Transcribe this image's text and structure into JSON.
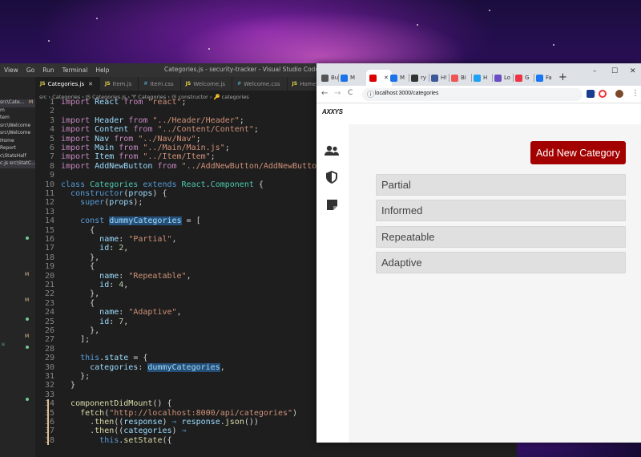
{
  "vscode": {
    "menu": [
      "View",
      "Go",
      "Run",
      "Terminal",
      "Help"
    ],
    "window_title": "Categories.js - security-tracker - Visual Studio Code",
    "tabs": [
      {
        "type": "JS",
        "label": "Categories.js",
        "close": "✕",
        "active": true
      },
      {
        "type": "JS",
        "label": "Item.js",
        "active": false
      },
      {
        "type": "#",
        "label": "Item.css",
        "active": false
      },
      {
        "type": "JS",
        "label": "Welcome.js",
        "active": false
      },
      {
        "type": "#",
        "label": "Welcome.css",
        "active": false
      },
      {
        "type": "JS",
        "label": "Home",
        "active": false
      }
    ],
    "breadcrumb": "src › Categories › JS Categories.js › 🝖 Categories › ⓜ constructor › 🔑 categories",
    "explorer": [
      {
        "name": "src\\Cate...",
        "mark": "M"
      },
      {
        "name": "m",
        "mark": ""
      },
      {
        "name": "tem",
        "mark": ""
      },
      {
        "name": "src\\Welcome",
        "mark": ""
      },
      {
        "name": "src\\Welcome",
        "mark": ""
      },
      {
        "name": "Home",
        "mark": ""
      },
      {
        "name": "Report",
        "mark": ""
      },
      {
        "name": "c\\StatsHalf",
        "mark": ""
      },
      {
        "name": "c.js src\\StatC...",
        "mark": ""
      }
    ],
    "explorer_marks": [
      "M",
      "M",
      "M",
      "u"
    ],
    "code_lines": [
      {
        "n": "1",
        "tokens": [
          [
            "kw2",
            "import "
          ],
          [
            "var",
            "React "
          ],
          [
            "kw2",
            "from "
          ],
          [
            "str",
            "\"react\""
          ],
          [
            "pl",
            ";"
          ]
        ]
      },
      {
        "n": "2",
        "tokens": []
      },
      {
        "n": "3",
        "tokens": [
          [
            "kw2",
            "import "
          ],
          [
            "var",
            "Header "
          ],
          [
            "kw2",
            "from "
          ],
          [
            "str",
            "\"../Header/Header\""
          ],
          [
            "pl",
            ";"
          ]
        ]
      },
      {
        "n": "4",
        "tokens": [
          [
            "kw2",
            "import "
          ],
          [
            "var",
            "Content "
          ],
          [
            "kw2",
            "from "
          ],
          [
            "str",
            "\"../Content/Content\""
          ],
          [
            "pl",
            ";"
          ]
        ]
      },
      {
        "n": "5",
        "tokens": [
          [
            "kw2",
            "import "
          ],
          [
            "var",
            "Nav "
          ],
          [
            "kw2",
            "from "
          ],
          [
            "str",
            "\"../Nav/Nav\""
          ],
          [
            "pl",
            ";"
          ]
        ]
      },
      {
        "n": "6",
        "tokens": [
          [
            "kw2",
            "import "
          ],
          [
            "var",
            "Main "
          ],
          [
            "kw2",
            "from "
          ],
          [
            "str",
            "\"../Main/Main.js\""
          ],
          [
            "pl",
            ";"
          ]
        ]
      },
      {
        "n": "7",
        "tokens": [
          [
            "kw2",
            "import "
          ],
          [
            "var",
            "Item "
          ],
          [
            "kw2",
            "from "
          ],
          [
            "str",
            "\"../Item/Item\""
          ],
          [
            "pl",
            ";"
          ]
        ]
      },
      {
        "n": "8",
        "tokens": [
          [
            "kw2",
            "import "
          ],
          [
            "var",
            "AddNewButton "
          ],
          [
            "kw2",
            "from "
          ],
          [
            "str",
            "\"../AddNewButton/AddNewButton\""
          ]
        ]
      },
      {
        "n": "9",
        "tokens": []
      },
      {
        "n": "10",
        "tokens": [
          [
            "kw",
            "class "
          ],
          [
            "cls",
            "Categories "
          ],
          [
            "kw",
            "extends "
          ],
          [
            "cls",
            "React"
          ],
          [
            "pl",
            "."
          ],
          [
            "cls",
            "Component "
          ],
          [
            "pl",
            "{"
          ]
        ]
      },
      {
        "n": "11",
        "tokens": [
          [
            "pl",
            "  "
          ],
          [
            "kw",
            "constructor"
          ],
          [
            "pl",
            "("
          ],
          [
            "var",
            "props"
          ],
          [
            "pl",
            ") {"
          ]
        ]
      },
      {
        "n": "12",
        "tokens": [
          [
            "pl",
            "    "
          ],
          [
            "kw",
            "super"
          ],
          [
            "pl",
            "("
          ],
          [
            "var",
            "props"
          ],
          [
            "pl",
            ");"
          ]
        ]
      },
      {
        "n": "13",
        "tokens": []
      },
      {
        "n": "14",
        "tokens": [
          [
            "pl",
            "    "
          ],
          [
            "kw",
            "const "
          ],
          [
            "var",
            "dummyCategories"
          ],
          [
            "pl",
            " = ["
          ]
        ]
      },
      {
        "n": "15",
        "tokens": [
          [
            "pl",
            "      {"
          ]
        ]
      },
      {
        "n": "16",
        "tokens": [
          [
            "pl",
            "        "
          ],
          [
            "var",
            "name"
          ],
          [
            "pl",
            ": "
          ],
          [
            "str",
            "\"Partial\""
          ],
          [
            "pl",
            ","
          ]
        ]
      },
      {
        "n": "17",
        "tokens": [
          [
            "pl",
            "        "
          ],
          [
            "var",
            "id"
          ],
          [
            "pl",
            ": "
          ],
          [
            "num",
            "2"
          ],
          [
            "pl",
            ","
          ]
        ]
      },
      {
        "n": "18",
        "tokens": [
          [
            "pl",
            "      },"
          ]
        ]
      },
      {
        "n": "19",
        "tokens": [
          [
            "pl",
            "      {"
          ]
        ]
      },
      {
        "n": "20",
        "tokens": [
          [
            "pl",
            "        "
          ],
          [
            "var",
            "name"
          ],
          [
            "pl",
            ": "
          ],
          [
            "str",
            "\"Repeatable\""
          ],
          [
            "pl",
            ","
          ]
        ]
      },
      {
        "n": "21",
        "tokens": [
          [
            "pl",
            "        "
          ],
          [
            "var",
            "id"
          ],
          [
            "pl",
            ": "
          ],
          [
            "num",
            "4"
          ],
          [
            "pl",
            ","
          ]
        ]
      },
      {
        "n": "22",
        "tokens": [
          [
            "pl",
            "      },"
          ]
        ]
      },
      {
        "n": "23",
        "tokens": [
          [
            "pl",
            "      {"
          ]
        ]
      },
      {
        "n": "24",
        "tokens": [
          [
            "pl",
            "        "
          ],
          [
            "var",
            "name"
          ],
          [
            "pl",
            ": "
          ],
          [
            "str",
            "\"Adaptive\""
          ],
          [
            "pl",
            ","
          ]
        ]
      },
      {
        "n": "25",
        "tokens": [
          [
            "pl",
            "        "
          ],
          [
            "var",
            "id"
          ],
          [
            "pl",
            ": "
          ],
          [
            "num",
            "7"
          ],
          [
            "pl",
            ","
          ]
        ]
      },
      {
        "n": "26",
        "tokens": [
          [
            "pl",
            "      },"
          ]
        ]
      },
      {
        "n": "27",
        "tokens": [
          [
            "pl",
            "    ];"
          ]
        ]
      },
      {
        "n": "28",
        "tokens": []
      },
      {
        "n": "29",
        "tokens": [
          [
            "pl",
            "    "
          ],
          [
            "kw",
            "this"
          ],
          [
            "pl",
            "."
          ],
          [
            "var",
            "state"
          ],
          [
            "pl",
            " = {"
          ]
        ]
      },
      {
        "n": "30",
        "tokens": [
          [
            "pl",
            "      "
          ],
          [
            "var",
            "categories"
          ],
          [
            "pl",
            ": "
          ],
          [
            "var",
            "dummyCategories"
          ],
          [
            "pl",
            ","
          ]
        ]
      },
      {
        "n": "31",
        "tokens": [
          [
            "pl",
            "    };"
          ]
        ]
      },
      {
        "n": "32",
        "tokens": [
          [
            "pl",
            "  }"
          ]
        ]
      },
      {
        "n": "33",
        "tokens": []
      },
      {
        "n": "34",
        "tokens": [
          [
            "pl",
            "  "
          ],
          [
            "fn",
            "componentDidMount"
          ],
          [
            "pl",
            "() {"
          ]
        ]
      },
      {
        "n": "35",
        "tokens": [
          [
            "pl",
            "    "
          ],
          [
            "fn",
            "fetch"
          ],
          [
            "pl",
            "("
          ],
          [
            "str",
            "\"http://localhost:8000/api/categories\""
          ],
          [
            "pl",
            ")"
          ]
        ]
      },
      {
        "n": "36",
        "tokens": [
          [
            "pl",
            "      ."
          ],
          [
            "fn",
            "then"
          ],
          [
            "pl",
            "(("
          ],
          [
            "var",
            "response"
          ],
          [
            "pl",
            ") "
          ],
          [
            "kw",
            "⇒ "
          ],
          [
            "var",
            "response"
          ],
          [
            "pl",
            "."
          ],
          [
            "fn",
            "json"
          ],
          [
            "pl",
            "())"
          ]
        ]
      },
      {
        "n": "37",
        "tokens": [
          [
            "pl",
            "      ."
          ],
          [
            "fn",
            "then"
          ],
          [
            "pl",
            "(("
          ],
          [
            "var",
            "categories"
          ],
          [
            "pl",
            ") "
          ],
          [
            "kw",
            "⇒"
          ]
        ]
      },
      {
        "n": "38",
        "tokens": [
          [
            "pl",
            "        "
          ],
          [
            "kw",
            "this"
          ],
          [
            "pl",
            "."
          ],
          [
            "fn",
            "setState"
          ],
          [
            "pl",
            "({"
          ]
        ]
      }
    ]
  },
  "chrome": {
    "tabs": [
      {
        "label": "Bu",
        "color": "#555"
      },
      {
        "label": "M",
        "color": "#1a73e8"
      },
      {
        "label": "",
        "color": "#d00"
      },
      {
        "label": "M",
        "color": "#1a73e8"
      },
      {
        "label": "ry",
        "color": "#333"
      },
      {
        "label": "H!",
        "color": "#3c5a99"
      },
      {
        "label": "Bi",
        "color": "#e55"
      },
      {
        "label": "H",
        "color": "#1da1f2"
      },
      {
        "label": "Lo",
        "color": "#6a4cc3"
      },
      {
        "label": "G",
        "color": "#e34"
      },
      {
        "label": "Fa",
        "color": "#1877f2"
      }
    ],
    "active_tab_close": "✕",
    "new_tab": "+",
    "window_controls": [
      "–",
      "☐",
      "✕"
    ],
    "nav": {
      "back": "←",
      "forward": "→",
      "reload": "C"
    },
    "url": "localhost:3000/categories",
    "info_icon": "ⓘ",
    "star": "☆",
    "menu": "⋮"
  },
  "app": {
    "logo_text": "AXXYS",
    "nav_icons": [
      "users-icon",
      "shield-icon",
      "note-icon"
    ],
    "add_button_label": "Add New Category",
    "categories": [
      "Partial",
      "Informed",
      "Repeatable",
      "Adaptive"
    ],
    "accent": "#a30000"
  }
}
